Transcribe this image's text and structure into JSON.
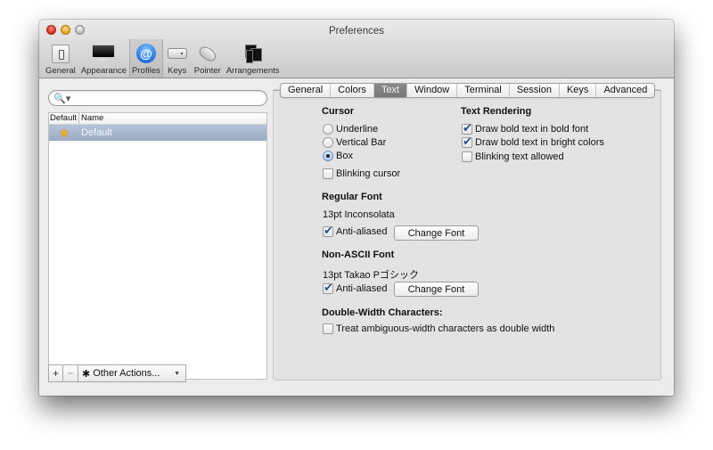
{
  "window": {
    "title": "Preferences"
  },
  "toolbar": {
    "items": [
      {
        "label": "General",
        "icon": "general-switch-icon",
        "selected": false
      },
      {
        "label": "Appearance",
        "icon": "monitor-icon",
        "selected": false
      },
      {
        "label": "Profiles",
        "icon": "at-sign-icon",
        "selected": true
      },
      {
        "label": "Keys",
        "icon": "keyboard-icon",
        "selected": false
      },
      {
        "label": "Pointer",
        "icon": "mouse-icon",
        "selected": false
      },
      {
        "label": "Arrangements",
        "icon": "windows-icon",
        "selected": false
      }
    ],
    "profiles_glyph": "@"
  },
  "profiles": {
    "search": {
      "value": "",
      "placeholder": "",
      "icon_glyph": "🔍▾"
    },
    "columns": [
      "Default",
      "Name"
    ],
    "rows": [
      {
        "is_default": true,
        "star_glyph": "★",
        "name": "Default",
        "selected": true
      }
    ],
    "add_label": "+",
    "remove_label": "−",
    "other_actions_label": "Other Actions...",
    "gear_glyph": "✱",
    "caret_glyph": "▼"
  },
  "tabs": [
    "General",
    "Colors",
    "Text",
    "Window",
    "Terminal",
    "Session",
    "Keys",
    "Advanced"
  ],
  "active_tab": "Text",
  "text_tab": {
    "cursor": {
      "heading": "Cursor",
      "options": [
        {
          "label": "Underline",
          "selected": false
        },
        {
          "label": "Vertical Bar",
          "selected": false
        },
        {
          "label": "Box",
          "selected": true
        }
      ],
      "blinking": {
        "label": "Blinking cursor",
        "checked": false
      }
    },
    "rendering": {
      "heading": "Text Rendering",
      "options": [
        {
          "label": "Draw bold text in bold font",
          "checked": true
        },
        {
          "label": "Draw bold text in bright colors",
          "checked": true
        },
        {
          "label": "Blinking text allowed",
          "checked": false
        }
      ]
    },
    "regular_font": {
      "heading": "Regular Font",
      "value": "13pt Inconsolata",
      "anti_aliased": {
        "label": "Anti-aliased",
        "checked": true
      },
      "button": "Change Font"
    },
    "non_ascii_font": {
      "heading": "Non-ASCII Font",
      "value": "13pt Takao Pゴシック",
      "anti_aliased": {
        "label": "Anti-aliased",
        "checked": true
      },
      "button": "Change Font"
    },
    "double_width": {
      "heading": "Double-Width Characters:",
      "option": {
        "label": "Treat ambiguous-width characters as double width",
        "checked": false
      }
    }
  }
}
